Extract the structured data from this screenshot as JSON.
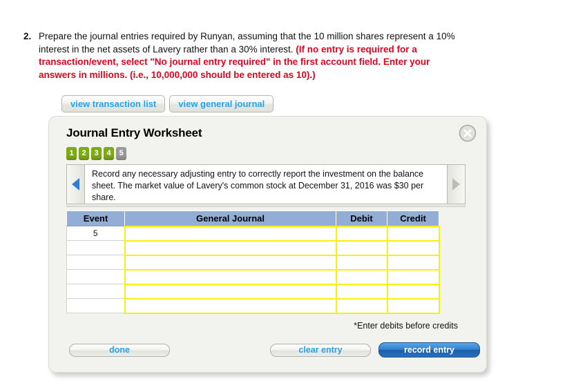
{
  "question": {
    "number": "2.",
    "line1": "Prepare the journal entries required by Runyan, assuming that the 10 million shares represent a 10% interest in the net assets of Lavery rather than a 30% interest. ",
    "line2_red": "(If no entry is required for a transaction/event, select \"No journal entry required\" in the first account field. Enter your answers in millions. (i.e., 10,000,000 should be entered as 10).)"
  },
  "view_buttons": {
    "transaction_list": "view transaction list",
    "general_journal": "view general journal"
  },
  "panel": {
    "title": "Journal Entry Worksheet",
    "close_icon": "close-circle-icon"
  },
  "steps": [
    {
      "label": "1",
      "state": "done"
    },
    {
      "label": "2",
      "state": "done"
    },
    {
      "label": "3",
      "state": "done"
    },
    {
      "label": "4",
      "state": "done"
    },
    {
      "label": "5",
      "state": "current"
    }
  ],
  "navigation": {
    "prev_icon": "triangle-left-icon",
    "next_icon": "triangle-right-icon",
    "prompt": "Record any necessary adjusting entry to correctly report the investment on the balance sheet. The market value of Lavery's common stock at December 31, 2016 was $30 per share."
  },
  "table": {
    "headers": [
      "Event",
      "General Journal",
      "Debit",
      "Credit"
    ],
    "rows": [
      {
        "event": "5",
        "general_journal": "",
        "debit": "",
        "credit": ""
      },
      {
        "event": "",
        "general_journal": "",
        "debit": "",
        "credit": ""
      },
      {
        "event": "",
        "general_journal": "",
        "debit": "",
        "credit": ""
      },
      {
        "event": "",
        "general_journal": "",
        "debit": "",
        "credit": ""
      },
      {
        "event": "",
        "general_journal": "",
        "debit": "",
        "credit": ""
      },
      {
        "event": "",
        "general_journal": "",
        "debit": "",
        "credit": ""
      }
    ],
    "note": "*Enter debits before credits"
  },
  "footer": {
    "done": "done",
    "clear_entry": "clear entry",
    "record_entry": "record entry"
  },
  "colors": {
    "accent_link": "#22a3ee",
    "header_blue": "#93aed6",
    "input_border_yellow": "#f7f010",
    "step_done_green": "#7fab1b",
    "step_current_gray": "#9b9b9b",
    "warning_red": "#e8001c",
    "record_button_blue": "#2f7fd0"
  }
}
